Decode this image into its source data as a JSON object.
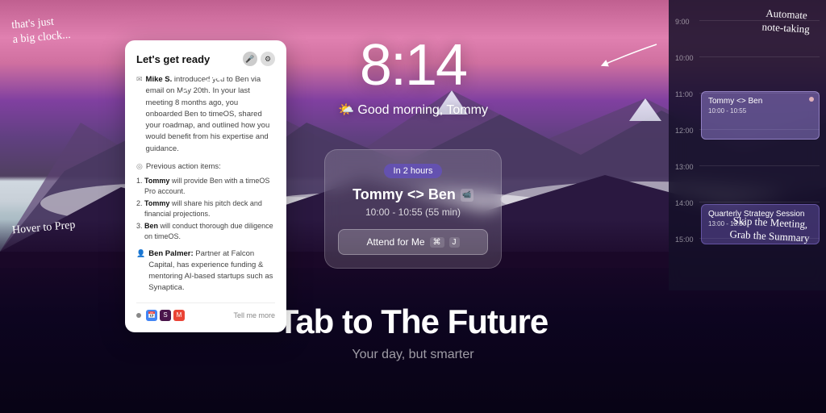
{
  "app": {
    "title": "Tab to The Future",
    "subtitle": "Your day, but smarter"
  },
  "annotations": {
    "top_left": "that's just\na big clock...",
    "top_right": "Automate\nnote-taking",
    "bottom_left": "Hover to Prep",
    "bottom_right": "Skip the Meeting,\nGrab the Summary"
  },
  "clock": {
    "time": "8:14",
    "greeting": "Good morning, Tommy",
    "weather_icon": "🌤️"
  },
  "prep_card": {
    "title": "Let's get ready",
    "mic_icon": "🎤",
    "intro_text": "Mike S. introduced you to Ben via email on May 20th. In your last meeting 8 months ago, you onboarded Ben to timeOS, shared your roadmap, and outlined how you would benefit from his expertise and guidance.",
    "action_label": "Previous action items:",
    "actions": [
      "Tommy will provide Ben with a timeOS Pro account.",
      "Tommy will share his pitch deck and financial projections.",
      "Ben will conduct thorough due diligence on timeOS."
    ],
    "person_label": "Ben Palmer:",
    "person_desc": "Partner at Falcon Capital, has experience funding & mentoring AI-based startups such as Synaptica.",
    "tell_more": "Tell me more"
  },
  "meeting_card": {
    "badge": "In 2 hours",
    "title": "Tommy <> Ben",
    "time": "10:00 - 10:55 (55 min)",
    "attend_btn": "Attend for Me",
    "kbd1": "⌘",
    "kbd2": "J"
  },
  "calendar": {
    "times": [
      "9:00",
      "10:00",
      "11:00",
      "12:00",
      "13:00",
      "14:00",
      "15:00"
    ],
    "events": [
      {
        "title": "Tommy <> Ben",
        "time": "10:00 - 10:55",
        "color": "purple-light"
      },
      {
        "title": "Quarterly Strategy Session",
        "time": "13:00 - 13:30",
        "color": "purple-dark"
      }
    ]
  }
}
